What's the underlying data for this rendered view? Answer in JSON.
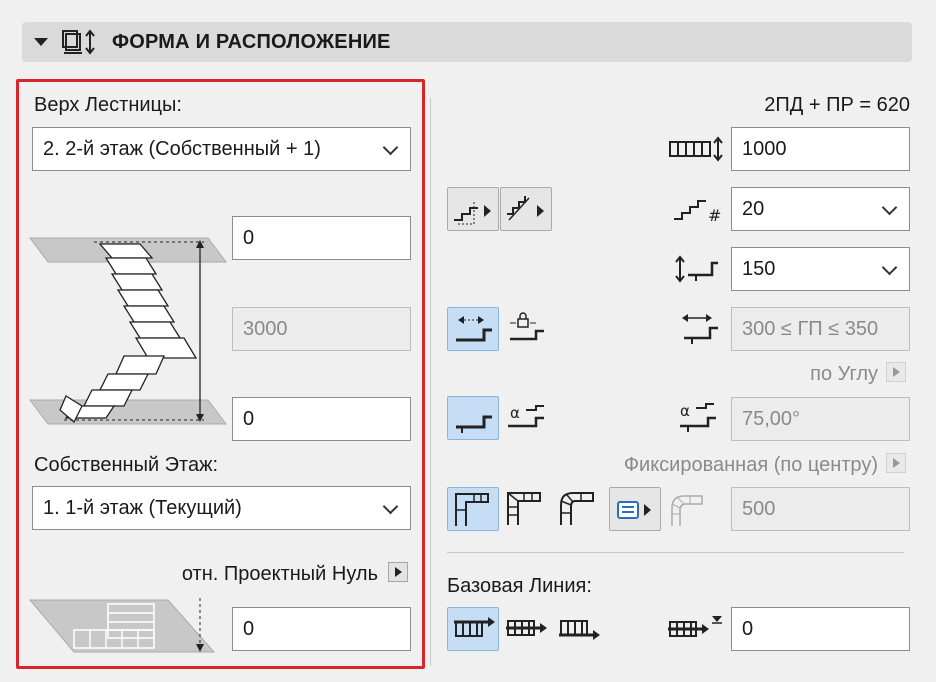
{
  "header": {
    "title": "ФОРМА И РАСПОЛОЖЕНИЕ"
  },
  "left": {
    "top_label": "Верх Лестницы:",
    "top_dropdown": "2. 2-й этаж (Собственный + 1)",
    "top_offset": "0",
    "height": "3000",
    "bottom_offset": "0",
    "home_story_label": "Собственный Этаж:",
    "home_story_dropdown": "1. 1-й этаж (Текущий)",
    "ref_label": "отн. Проектный Нуль",
    "elevation": "0"
  },
  "right": {
    "formula": "2ПД + ПР = 620",
    "width_value": "1000",
    "risers_value": "20",
    "riser_height_value": "150",
    "tread_depth_value": "300 ≤ ГП ≤ 350",
    "by_angle_label": "по Углу",
    "angle_value": "75,00°",
    "fixed_label": "Фиксированная (по центру)",
    "turn_value": "500",
    "baseline_label": "Базовая Линия:",
    "baseline_offset": "0"
  },
  "colors": {
    "highlight_box": "#d9242a",
    "toggle_on": "#c5def5"
  }
}
